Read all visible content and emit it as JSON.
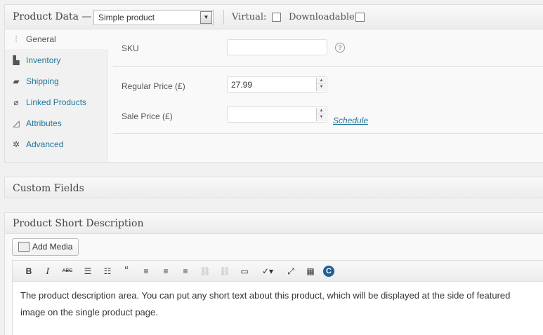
{
  "product_data": {
    "title": "Product Data —",
    "type_select": "Simple product",
    "virtual_label": "Virtual:",
    "downloadable_label": "Downloadable:",
    "tabs": [
      {
        "label": "General",
        "icon": "sliders-icon"
      },
      {
        "label": "Inventory",
        "icon": "boxes-icon"
      },
      {
        "label": "Shipping",
        "icon": "truck-icon"
      },
      {
        "label": "Linked Products",
        "icon": "link-icon"
      },
      {
        "label": "Attributes",
        "icon": "tag-icon"
      },
      {
        "label": "Advanced",
        "icon": "gear-icon"
      }
    ],
    "fields": {
      "sku_label": "SKU",
      "sku_value": "",
      "regular_price_label": "Regular Price (£)",
      "regular_price_value": "27.99",
      "sale_price_label": "Sale Price (£)",
      "sale_price_value": "",
      "schedule_link": "Schedule"
    }
  },
  "custom_fields": {
    "title": "Custom Fields"
  },
  "short_description": {
    "title": "Product Short Description",
    "add_media": "Add Media",
    "toolbar": {
      "bold": "B",
      "italic": "I",
      "strikethrough": "ABC",
      "blockquote": "“"
    },
    "content": "The product description area. You can put any short text about this product, which will be displayed at the side of featured image on the single product page."
  }
}
